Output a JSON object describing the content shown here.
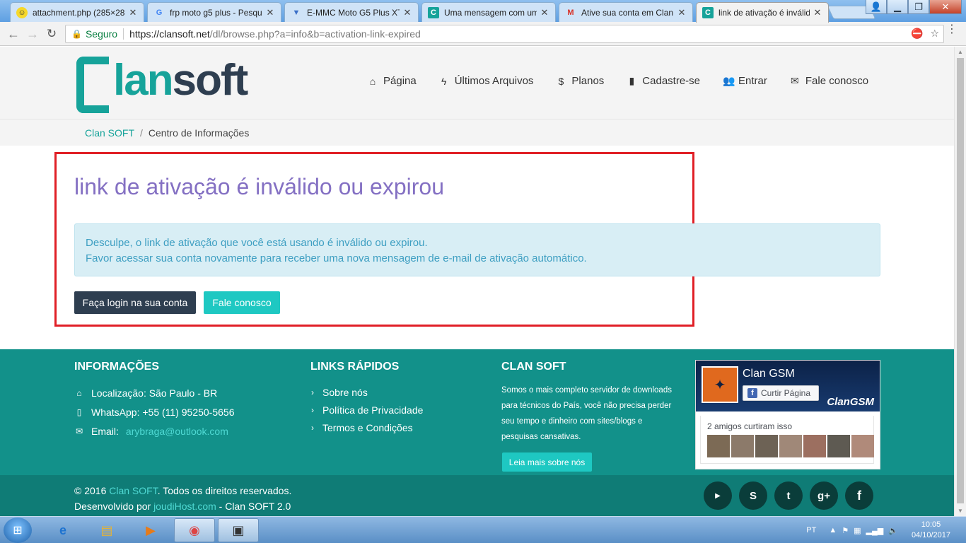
{
  "browser": {
    "tabs": [
      {
        "title": "attachment.php (285×28",
        "favicon": "smiley-icon",
        "active": false
      },
      {
        "title": "frp moto g5 plus - Pesqu",
        "favicon": "google-icon",
        "active": false
      },
      {
        "title": "E-MMC Moto G5 Plus XT",
        "favicon": "arrow-down-icon",
        "active": false
      },
      {
        "title": "Uma mensagem com um",
        "favicon": "clansoft-icon",
        "active": false
      },
      {
        "title": "Ative sua conta em Clan",
        "favicon": "gmail-icon",
        "active": false
      },
      {
        "title": "link de ativação é inválid",
        "favicon": "clansoft-icon",
        "active": true
      }
    ],
    "secure_label": "Seguro",
    "url_host": "https://clansoft.net",
    "url_path": "/dl/browse.php?a=info&b=activation-link-expired"
  },
  "site": {
    "logo": {
      "part1": "lan",
      "part2": "soft"
    },
    "nav": [
      {
        "label": "Página",
        "icon": "home-icon"
      },
      {
        "label": "Últimos Arquivos",
        "icon": "bolt-icon"
      },
      {
        "label": "Planos",
        "icon": "dollar-icon"
      },
      {
        "label": "Cadastre-se",
        "icon": "file-icon"
      },
      {
        "label": "Entrar",
        "icon": "users-icon"
      },
      {
        "label": "Fale conosco",
        "icon": "envelope-icon"
      }
    ],
    "breadcrumb": {
      "home": "Clan SOFT",
      "separator": "/",
      "current": "Centro de Informações"
    }
  },
  "main": {
    "title": "link de ativação é inválido ou expirou",
    "alert_line1": "Desculpe, o link de ativação que você está usando é inválido ou expirou.",
    "alert_line2": "Favor acessar sua conta novamente para receber uma nova mensagem de e-mail de ativação automático.",
    "login_button": "Faça login na sua conta",
    "contact_button": "Fale conosco"
  },
  "footer": {
    "info_title": "INFORMAÇÕES",
    "location": "Localização: São Paulo - BR",
    "whatsapp": "WhatsApp: +55 (11) 95250-5656",
    "email_label": "Email:",
    "email": "arybraga@outlook.com",
    "links_title": "LINKS RÁPIDOS",
    "links": [
      "Sobre nós",
      "Política de Privacidade",
      "Termos e Condições"
    ],
    "clansoft_title": "CLAN SOFT",
    "clansoft_text": "Somos o mais completo servidor de downloads para técnicos do País, você não precisa perder seu tempo e dinheiro com sites/blogs e pesquisas cansativas.",
    "read_more": "Leia mais sobre nós",
    "fb": {
      "page_name": "Clan GSM",
      "like_label": "Curtir Página",
      "brand": "ClanGSM",
      "friends_text": "2 amigos curtiram isso"
    },
    "copyright_pre": "© 2016",
    "copyright_link": "Clan SOFT",
    "copyright_post": ". Todos os direitos reservados.",
    "dev_pre": "Desenvolvido por",
    "dev_link": "joudiHost.com",
    "dev_post": "- Clan SOFT 2.0"
  },
  "taskbar": {
    "lang": "PT",
    "time": "10:05",
    "date": "04/10/2017"
  },
  "colors": {
    "accent": "#16a39a",
    "title_purple": "#8470c3",
    "dark": "#2e3e50",
    "footer": "#12918a",
    "highlight": "#e01f26"
  }
}
